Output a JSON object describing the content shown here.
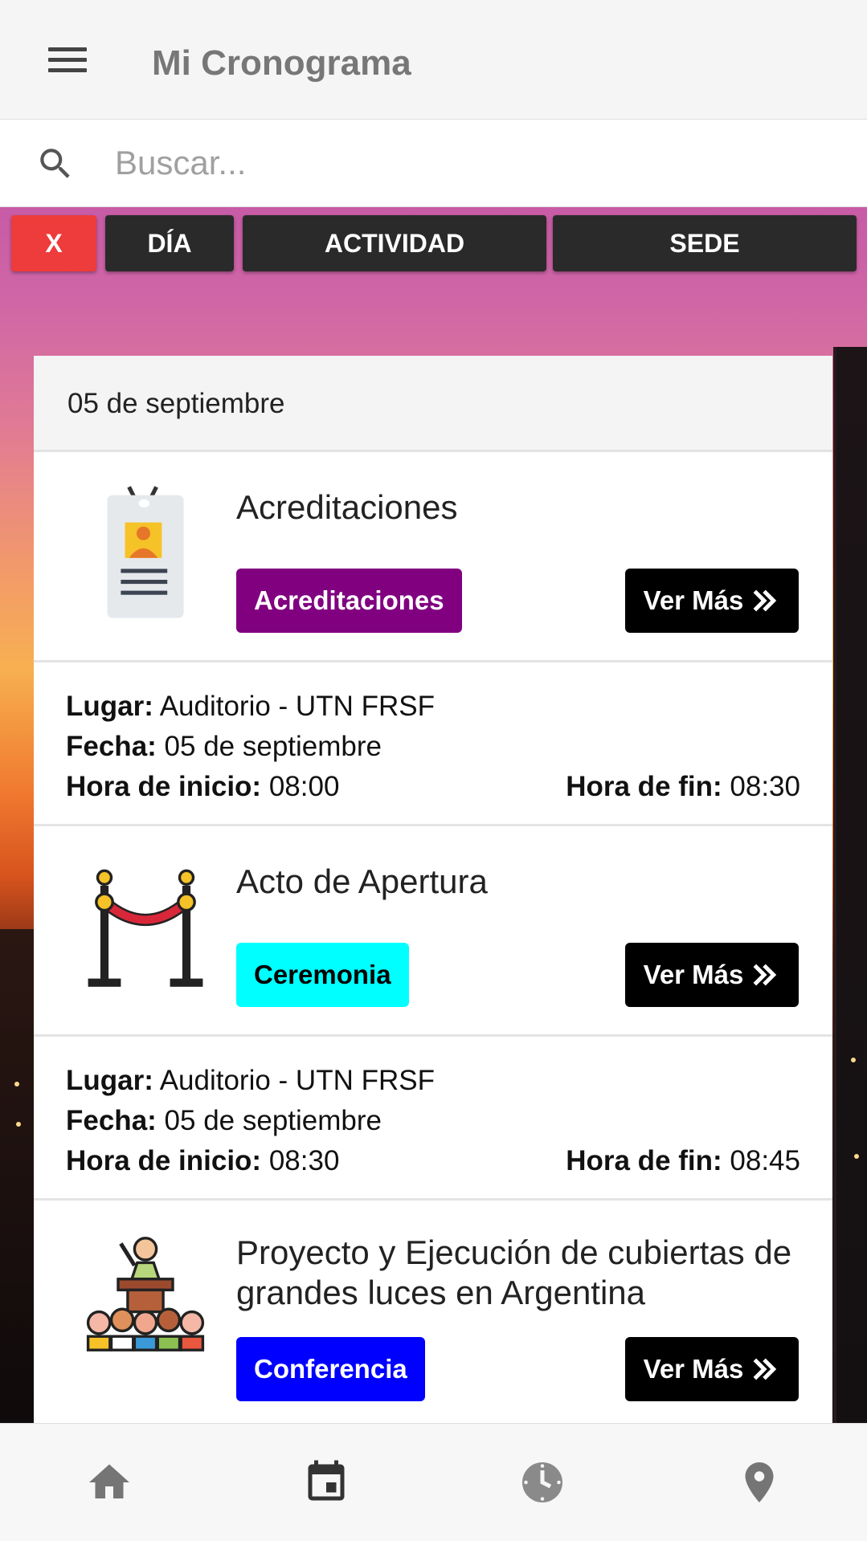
{
  "app_bar": {
    "title": "Mi Cronograma",
    "menu_icon": "hamburger-menu-icon"
  },
  "search": {
    "placeholder": "Buscar...",
    "value": "",
    "icon": "search-icon"
  },
  "filters": {
    "clear_label": "X",
    "day_label": "DÍA",
    "activity_label": "ACTIVIDAD",
    "venue_label": "SEDE"
  },
  "schedule": {
    "date_header": "05 de septiembre",
    "labels": {
      "place": "Lugar:",
      "date": "Fecha:",
      "start": "Hora de inicio:",
      "end": "Hora de fin:"
    },
    "activities": [
      {
        "title": "Acreditaciones",
        "tag": "Acreditaciones",
        "tag_color": "#800080",
        "tag_text_color": "#ffffff",
        "icon": "id-badge-icon",
        "more_label": "Ver Más",
        "place": "Auditorio - UTN FRSF",
        "date": "05 de septiembre",
        "start": "08:00",
        "end": "08:30"
      },
      {
        "title": "Acto de Apertura",
        "tag": "Ceremonia",
        "tag_color": "#00ffff",
        "tag_text_color": "#000000",
        "icon": "rope-barrier-icon",
        "more_label": "Ver Más",
        "place": "Auditorio - UTN FRSF",
        "date": "05 de septiembre",
        "start": "08:30",
        "end": "08:45"
      },
      {
        "title": "Proyecto y Ejecución de cubiertas de grandes luces en Argentina",
        "tag": "Conferencia",
        "tag_color": "#0000ff",
        "tag_text_color": "#ffffff",
        "icon": "speaker-audience-icon",
        "more_label": "Ver Más"
      }
    ]
  },
  "bottom_nav": [
    {
      "name": "home",
      "icon": "home-icon",
      "active": false
    },
    {
      "name": "schedule",
      "icon": "calendar-icon",
      "active": true
    },
    {
      "name": "time",
      "icon": "clock-icon",
      "active": false
    },
    {
      "name": "location",
      "icon": "location-pin-icon",
      "active": false
    }
  ]
}
